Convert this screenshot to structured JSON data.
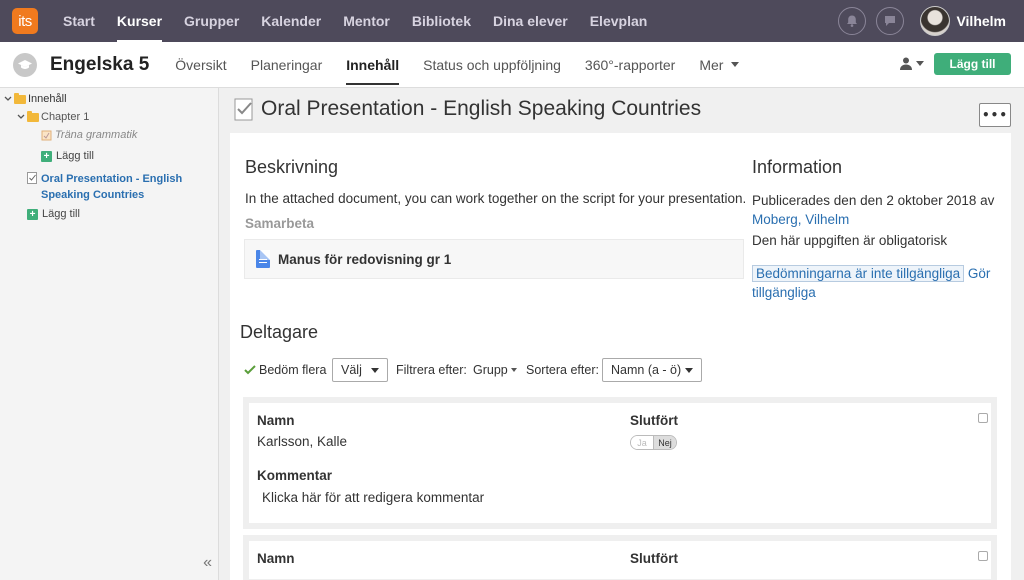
{
  "topnav": {
    "logo_text": "its",
    "items": [
      {
        "label": "Start"
      },
      {
        "label": "Kurser",
        "active": true
      },
      {
        "label": "Grupper"
      },
      {
        "label": "Kalender"
      },
      {
        "label": "Mentor"
      },
      {
        "label": "Bibliotek"
      },
      {
        "label": "Dina elever"
      },
      {
        "label": "Elevplan"
      }
    ],
    "username": "Vilhelm"
  },
  "coursebar": {
    "title": "Engelska 5",
    "tabs": [
      {
        "label": "Översikt"
      },
      {
        "label": "Planeringar"
      },
      {
        "label": "Innehåll",
        "active": true
      },
      {
        "label": "Status och uppföljning"
      },
      {
        "label": "360°-rapporter"
      },
      {
        "label": "Mer"
      }
    ],
    "add_label": "Lägg till"
  },
  "sidebar": {
    "root": "Innehåll",
    "chapter": "Chapter 1",
    "chapter_item": "Träna grammatik",
    "chapter_add": "Lägg till",
    "active_item": "Oral Presentation - English Speaking Countries",
    "root_add": "Lägg till"
  },
  "main": {
    "title": "Oral Presentation - English Speaking Countries",
    "more_label": "•••",
    "description": {
      "heading": "Beskrivning",
      "text": "In the attached document, you can work together on the script for your presentation.",
      "collab_heading": "Samarbeta",
      "attachment": "Manus för redovisning gr 1"
    },
    "information": {
      "heading": "Information",
      "published_prefix": "Publicerades den den 2 oktober 2018 av",
      "author": "Moberg, Vilhelm",
      "mandatory": "Den här uppgiften är obligatorisk",
      "grades_unavailable": "Bedömningarna är inte tillgängliga",
      "make_available": "Gör tillgängliga"
    },
    "participants": {
      "heading": "Deltagare",
      "grade_many": "Bedöm flera",
      "choose": "Välj",
      "filter_label": "Filtrera efter:",
      "filter_value": "Grupp",
      "sort_label": "Sortera efter:",
      "sort_value": "Namn (a - ö)",
      "rows": [
        {
          "name_label": "Namn",
          "name": "Karlsson, Kalle",
          "done_label": "Slutfört",
          "yes": "Ja",
          "no": "Nej",
          "comment_label": "Kommentar",
          "comment": "Klicka här för att redigera kommentar"
        },
        {
          "name_label": "Namn",
          "done_label": "Slutfört"
        }
      ]
    }
  },
  "colors": {
    "topbar": "#4e4a5b",
    "logo": "#f07a1e",
    "accent_green": "#3fae7a",
    "link": "#2a6fb0"
  }
}
